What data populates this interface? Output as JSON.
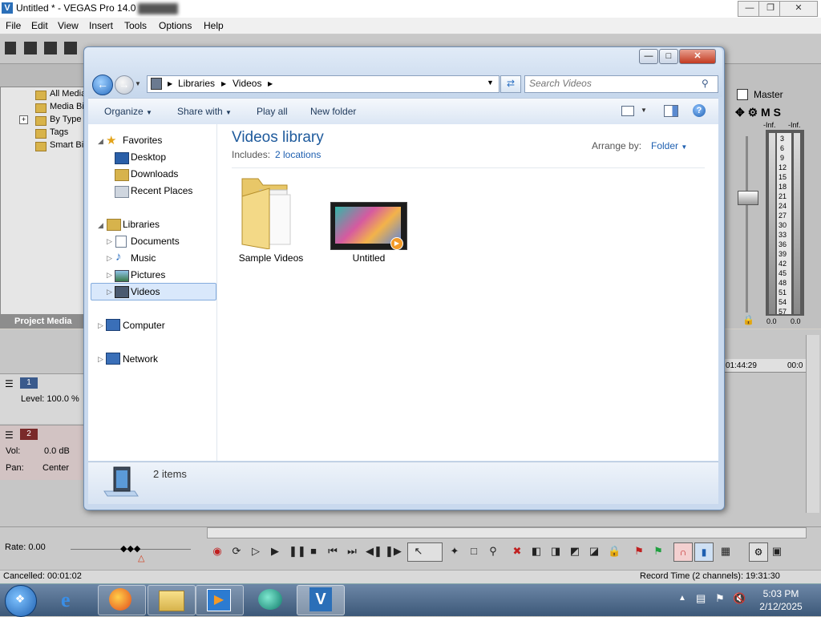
{
  "app": {
    "title": "Untitled * - VEGAS Pro 14.0",
    "menus": [
      "File",
      "Edit",
      "View",
      "Insert",
      "Tools",
      "Options",
      "Help"
    ],
    "media_tree": [
      "All Media",
      "Media Bi",
      "By Type",
      "Tags",
      "Smart Bi"
    ],
    "project_media_tab": "Project Media",
    "master_label": "Master",
    "meter_top_labels": [
      "-Inf.",
      "-Inf."
    ],
    "meter_scale": [
      "3",
      "6",
      "9",
      "12",
      "15",
      "18",
      "21",
      "24",
      "27",
      "30",
      "33",
      "36",
      "39",
      "42",
      "45",
      "48",
      "51",
      "54",
      "57"
    ],
    "meter_bottom": [
      "0.0",
      "0.0"
    ],
    "timeline_times": [
      "01:44:29",
      "00:0"
    ],
    "track1": {
      "num": "1",
      "level": "Level: 100.0 %"
    },
    "track2": {
      "num": "2",
      "vol_label": "Vol:",
      "vol_value": "0.0 dB",
      "pan_label": "Pan:",
      "pan_value": "Center"
    },
    "rate": "Rate: 0.00",
    "status_left": "Cancelled: 00:01:02",
    "status_right": "Record Time (2 channels): 19:31:30"
  },
  "explorer": {
    "address": [
      "Libraries",
      "Videos"
    ],
    "search_placeholder": "Search Videos",
    "toolbar": {
      "organize": "Organize",
      "share_with": "Share with",
      "play_all": "Play all",
      "new_folder": "New folder"
    },
    "nav": {
      "favorites": "Favorites",
      "favorites_items": [
        "Desktop",
        "Downloads",
        "Recent Places"
      ],
      "libraries": "Libraries",
      "libraries_items": [
        "Documents",
        "Music",
        "Pictures",
        "Videos"
      ],
      "computer": "Computer",
      "network": "Network"
    },
    "library_title": "Videos library",
    "includes_label": "Includes:",
    "includes_link": "2 locations",
    "arrange_label": "Arrange by:",
    "arrange_value": "Folder",
    "items": [
      "Sample Videos",
      "Untitled"
    ],
    "details": "2 items"
  },
  "taskbar": {
    "time": "5:03 PM",
    "date": "2/12/2025"
  }
}
